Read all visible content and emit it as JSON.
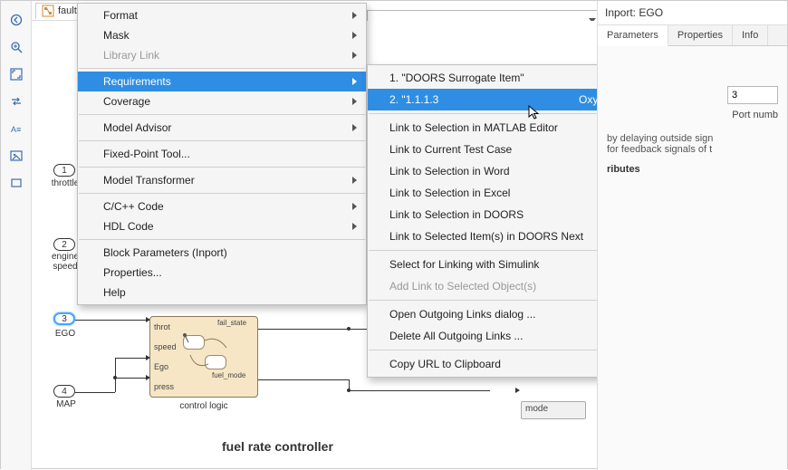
{
  "tab": {
    "label": "fault"
  },
  "left_toolbar": {
    "icons": [
      "back-icon",
      "zoom-icon",
      "fit-icon",
      "100-icon",
      "text-icon",
      "image-icon",
      "rect-icon"
    ]
  },
  "context_menu": {
    "items": [
      {
        "label": "Format",
        "sub": true
      },
      {
        "label": "Mask",
        "sub": true
      },
      {
        "label": "Library Link",
        "sub": true,
        "disabled": true
      },
      {
        "sep": true
      },
      {
        "label": "Requirements",
        "sub": true,
        "hover": true
      },
      {
        "label": "Coverage",
        "sub": true
      },
      {
        "sep": true
      },
      {
        "label": "Model Advisor",
        "sub": true
      },
      {
        "sep": true
      },
      {
        "label": "Fixed-Point Tool..."
      },
      {
        "sep": true
      },
      {
        "label": "Model Transformer",
        "sub": true
      },
      {
        "sep": true
      },
      {
        "label": "C/C++ Code",
        "sub": true
      },
      {
        "label": "HDL Code",
        "sub": true
      },
      {
        "sep": true
      },
      {
        "label": "Block Parameters (Inport)"
      },
      {
        "label": "Properties..."
      },
      {
        "label": "Help"
      }
    ]
  },
  "submenu": {
    "items": [
      {
        "label": "1. \"DOORS Surrogate Item\""
      },
      {
        "label": "2. \"1.1.1.3",
        "extra": "Oxygen Sensor\"",
        "hover": true
      },
      {
        "sep": true
      },
      {
        "label": "Link to Selection in MATLAB Editor"
      },
      {
        "label": "Link to Current Test Case"
      },
      {
        "label": "Link to Selection in Word"
      },
      {
        "label": "Link to Selection in Excel"
      },
      {
        "label": "Link to Selection in DOORS"
      },
      {
        "label": "Link to Selected Item(s) in DOORS Next"
      },
      {
        "sep": true
      },
      {
        "label": "Select for Linking with Simulink"
      },
      {
        "label": "Add Link to Selected Object(s)",
        "disabled": true
      },
      {
        "sep": true
      },
      {
        "label": "Open Outgoing Links dialog ..."
      },
      {
        "label": "Delete All Outgoing Links ..."
      },
      {
        "sep": true
      },
      {
        "label": "Copy URL to Clipboard"
      }
    ]
  },
  "ports": {
    "p1": {
      "num": "1",
      "label": "throttle"
    },
    "p2": {
      "num": "2",
      "label": "engine\nspeed"
    },
    "p3": {
      "num": "3",
      "label": "EGO"
    },
    "p4": {
      "num": "4",
      "label": "MAP"
    }
  },
  "control_logic": {
    "caption": "control logic",
    "pins": {
      "throt": "throt",
      "speed": "speed",
      "ego": "Ego",
      "press": "press"
    },
    "labels": {
      "fail_state": "fail_state",
      "fuel_mode": "fuel_mode"
    }
  },
  "mode_block": {
    "label": "mode"
  },
  "title": "fuel rate controller",
  "inspector": {
    "title": "Inport: EGO",
    "tabs": {
      "parameters": "Parameters",
      "properties": "Properties",
      "info": "Info"
    },
    "port_value": "3",
    "port_label": "Port numb",
    "desc1": "by delaying outside sign",
    "desc2": "for feedback signals of t",
    "attributes_label": "ributes"
  }
}
